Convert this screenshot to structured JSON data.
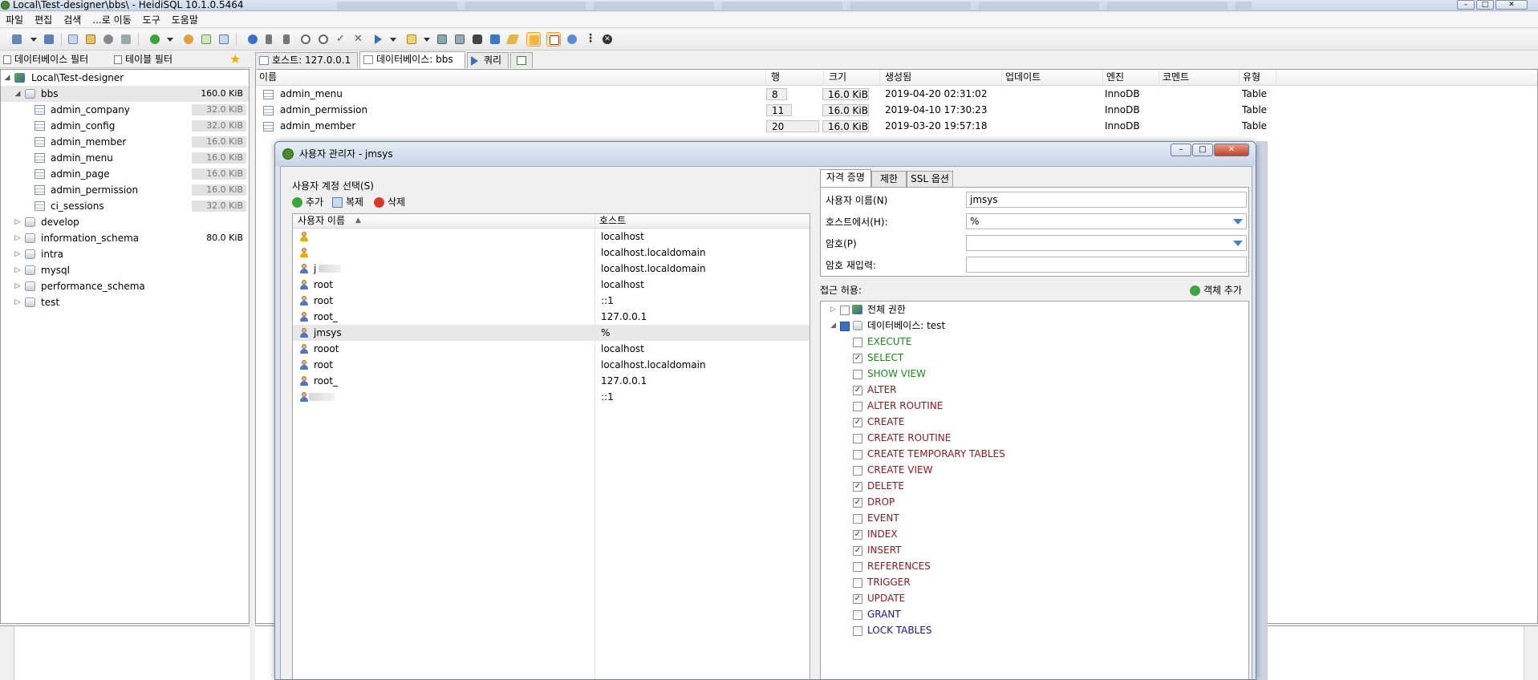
{
  "window": {
    "title": "Local\\Test-designer\\bbs\\ - HeidiSQL 10.1.0.5464"
  },
  "menu": [
    "파일",
    "편집",
    "검색",
    "...로 이동",
    "도구",
    "도움말"
  ],
  "filters": {
    "db_filter": "데이터베이스 필터",
    "table_filter": "테이블 필터"
  },
  "tree": {
    "root": "Local\\Test-designer",
    "databases": [
      {
        "name": "bbs",
        "size": "160.0 KiB",
        "tables": [
          {
            "name": "admin_company",
            "size": "32.0 KiB"
          },
          {
            "name": "admin_config",
            "size": "32.0 KiB"
          },
          {
            "name": "admin_member",
            "size": "16.0 KiB"
          },
          {
            "name": "admin_menu",
            "size": "16.0 KiB"
          },
          {
            "name": "admin_page",
            "size": "16.0 KiB"
          },
          {
            "name": "admin_permission",
            "size": "16.0 KiB"
          },
          {
            "name": "ci_sessions",
            "size": "32.0 KiB"
          }
        ]
      },
      {
        "name": "develop",
        "size": ""
      },
      {
        "name": "information_schema",
        "size": "80.0 KiB"
      },
      {
        "name": "intra",
        "size": ""
      },
      {
        "name": "mysql",
        "size": ""
      },
      {
        "name": "performance_schema",
        "size": ""
      },
      {
        "name": "test",
        "size": ""
      }
    ]
  },
  "tabs": [
    {
      "label": "호스트: 127.0.0.1"
    },
    {
      "label": "데이터베이스: bbs"
    },
    {
      "label": "쿼리"
    }
  ],
  "grid": {
    "columns": [
      "이름",
      "행",
      "크기",
      "생성됨",
      "업데이트",
      "엔진",
      "코멘트",
      "유형"
    ],
    "rows": [
      {
        "name": "admin_menu",
        "rows": "8",
        "size": "16.0 KiB",
        "created": "2019-04-20 02:31:02",
        "updated": "",
        "engine": "InnoDB",
        "comment": "",
        "type": "Table"
      },
      {
        "name": "admin_permission",
        "rows": "11",
        "size": "16.0 KiB",
        "created": "2019-04-10 17:30:23",
        "updated": "",
        "engine": "InnoDB",
        "comment": "",
        "type": "Table"
      },
      {
        "name": "admin_member",
        "rows": "20",
        "size": "16.0 KiB",
        "created": "2019-03-20 19:57:18",
        "updated": "",
        "engine": "InnoDB",
        "comment": "",
        "type": "Table"
      }
    ]
  },
  "dialog": {
    "title": "사용자 관리자 - jmsys",
    "select_label": "사용자 계정 선택(S)",
    "add": "추가",
    "clone": "복제",
    "delete": "삭제",
    "list_headers": {
      "user": "사용자 이름",
      "host": "호스트"
    },
    "users": [
      {
        "user": "",
        "host": "localhost",
        "warn": true
      },
      {
        "user": "",
        "host": "localhost.localdomain",
        "warn": true
      },
      {
        "user": "j",
        "host": "localhost.localdomain",
        "warn": false
      },
      {
        "user": "root",
        "host": "localhost",
        "warn": false
      },
      {
        "user": "root",
        "host": "::1",
        "warn": false
      },
      {
        "user": "root_",
        "host": "127.0.0.1",
        "warn": false
      },
      {
        "user": "jmsys",
        "host": "%",
        "warn": false
      },
      {
        "user": "rooot",
        "host": "localhost",
        "warn": false
      },
      {
        "user": "root",
        "host": "localhost.localdomain",
        "warn": false
      },
      {
        "user": "root_",
        "host": "127.0.0.1",
        "warn": false
      },
      {
        "user": "",
        "host": "::1",
        "warn": false
      }
    ],
    "right_tabs": [
      "자격 증명",
      "제한",
      "SSL 옵션"
    ],
    "cred": {
      "username_label": "사용자 이름(N)",
      "username": "jmsys",
      "host_label": "호스트에서(H):",
      "host": "%",
      "password_label": "암호(P)",
      "password": "",
      "repeat_label": "암호 재입력:",
      "repeat": ""
    },
    "access_label": "접근 허용:",
    "add_object": "객체 추가",
    "global_priv": "전체 권한",
    "db_priv": "데이터베이스: test",
    "privileges": [
      {
        "name": "EXECUTE",
        "checked": false,
        "color": "#1d8a1d"
      },
      {
        "name": "SELECT",
        "checked": true,
        "color": "#1d8a1d"
      },
      {
        "name": "SHOW VIEW",
        "checked": false,
        "color": "#1d8a1d"
      },
      {
        "name": "ALTER",
        "checked": true,
        "color": "#8b1a1a"
      },
      {
        "name": "ALTER ROUTINE",
        "checked": false,
        "color": "#8b1a1a"
      },
      {
        "name": "CREATE",
        "checked": true,
        "color": "#8b1a1a"
      },
      {
        "name": "CREATE ROUTINE",
        "checked": false,
        "color": "#8b1a1a"
      },
      {
        "name": "CREATE TEMPORARY TABLES",
        "checked": false,
        "color": "#8b1a1a"
      },
      {
        "name": "CREATE VIEW",
        "checked": false,
        "color": "#8b1a1a"
      },
      {
        "name": "DELETE",
        "checked": true,
        "color": "#8b1a1a"
      },
      {
        "name": "DROP",
        "checked": true,
        "color": "#8b1a1a"
      },
      {
        "name": "EVENT",
        "checked": false,
        "color": "#8b1a1a"
      },
      {
        "name": "INDEX",
        "checked": true,
        "color": "#8b1a1a"
      },
      {
        "name": "INSERT",
        "checked": true,
        "color": "#8b1a1a"
      },
      {
        "name": "REFERENCES",
        "checked": false,
        "color": "#8b1a1a"
      },
      {
        "name": "TRIGGER",
        "checked": false,
        "color": "#8b1a1a"
      },
      {
        "name": "UPDATE",
        "checked": true,
        "color": "#8b1a1a"
      },
      {
        "name": "GRANT",
        "checked": false,
        "color": "#1a1a99"
      },
      {
        "name": "LOCK TABLES",
        "checked": false,
        "color": "#1a1a99"
      }
    ]
  }
}
